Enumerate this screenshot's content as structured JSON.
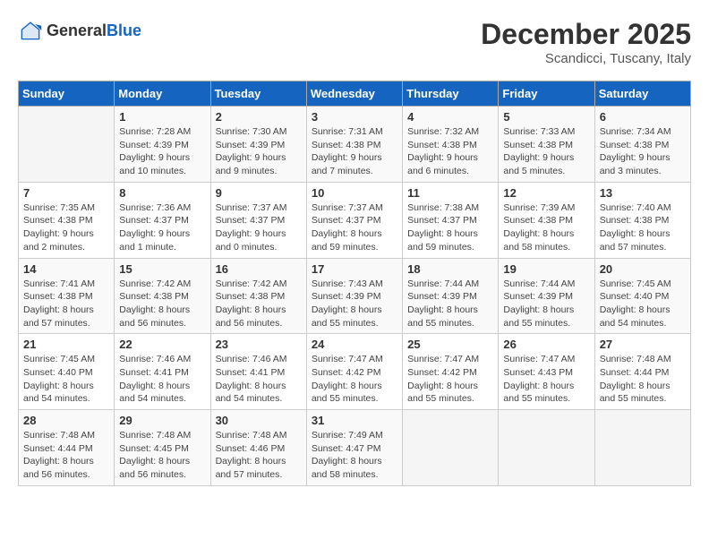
{
  "header": {
    "logo_general": "General",
    "logo_blue": "Blue",
    "month_year": "December 2025",
    "location": "Scandicci, Tuscany, Italy"
  },
  "days_of_week": [
    "Sunday",
    "Monday",
    "Tuesday",
    "Wednesday",
    "Thursday",
    "Friday",
    "Saturday"
  ],
  "weeks": [
    [
      {
        "day": "",
        "info": ""
      },
      {
        "day": "1",
        "info": "Sunrise: 7:28 AM\nSunset: 4:39 PM\nDaylight: 9 hours\nand 10 minutes."
      },
      {
        "day": "2",
        "info": "Sunrise: 7:30 AM\nSunset: 4:39 PM\nDaylight: 9 hours\nand 9 minutes."
      },
      {
        "day": "3",
        "info": "Sunrise: 7:31 AM\nSunset: 4:38 PM\nDaylight: 9 hours\nand 7 minutes."
      },
      {
        "day": "4",
        "info": "Sunrise: 7:32 AM\nSunset: 4:38 PM\nDaylight: 9 hours\nand 6 minutes."
      },
      {
        "day": "5",
        "info": "Sunrise: 7:33 AM\nSunset: 4:38 PM\nDaylight: 9 hours\nand 5 minutes."
      },
      {
        "day": "6",
        "info": "Sunrise: 7:34 AM\nSunset: 4:38 PM\nDaylight: 9 hours\nand 3 minutes."
      }
    ],
    [
      {
        "day": "7",
        "info": "Sunrise: 7:35 AM\nSunset: 4:38 PM\nDaylight: 9 hours\nand 2 minutes."
      },
      {
        "day": "8",
        "info": "Sunrise: 7:36 AM\nSunset: 4:37 PM\nDaylight: 9 hours\nand 1 minute."
      },
      {
        "day": "9",
        "info": "Sunrise: 7:37 AM\nSunset: 4:37 PM\nDaylight: 9 hours\nand 0 minutes."
      },
      {
        "day": "10",
        "info": "Sunrise: 7:37 AM\nSunset: 4:37 PM\nDaylight: 8 hours\nand 59 minutes."
      },
      {
        "day": "11",
        "info": "Sunrise: 7:38 AM\nSunset: 4:37 PM\nDaylight: 8 hours\nand 59 minutes."
      },
      {
        "day": "12",
        "info": "Sunrise: 7:39 AM\nSunset: 4:38 PM\nDaylight: 8 hours\nand 58 minutes."
      },
      {
        "day": "13",
        "info": "Sunrise: 7:40 AM\nSunset: 4:38 PM\nDaylight: 8 hours\nand 57 minutes."
      }
    ],
    [
      {
        "day": "14",
        "info": "Sunrise: 7:41 AM\nSunset: 4:38 PM\nDaylight: 8 hours\nand 57 minutes."
      },
      {
        "day": "15",
        "info": "Sunrise: 7:42 AM\nSunset: 4:38 PM\nDaylight: 8 hours\nand 56 minutes."
      },
      {
        "day": "16",
        "info": "Sunrise: 7:42 AM\nSunset: 4:38 PM\nDaylight: 8 hours\nand 56 minutes."
      },
      {
        "day": "17",
        "info": "Sunrise: 7:43 AM\nSunset: 4:39 PM\nDaylight: 8 hours\nand 55 minutes."
      },
      {
        "day": "18",
        "info": "Sunrise: 7:44 AM\nSunset: 4:39 PM\nDaylight: 8 hours\nand 55 minutes."
      },
      {
        "day": "19",
        "info": "Sunrise: 7:44 AM\nSunset: 4:39 PM\nDaylight: 8 hours\nand 55 minutes."
      },
      {
        "day": "20",
        "info": "Sunrise: 7:45 AM\nSunset: 4:40 PM\nDaylight: 8 hours\nand 54 minutes."
      }
    ],
    [
      {
        "day": "21",
        "info": "Sunrise: 7:45 AM\nSunset: 4:40 PM\nDaylight: 8 hours\nand 54 minutes."
      },
      {
        "day": "22",
        "info": "Sunrise: 7:46 AM\nSunset: 4:41 PM\nDaylight: 8 hours\nand 54 minutes."
      },
      {
        "day": "23",
        "info": "Sunrise: 7:46 AM\nSunset: 4:41 PM\nDaylight: 8 hours\nand 54 minutes."
      },
      {
        "day": "24",
        "info": "Sunrise: 7:47 AM\nSunset: 4:42 PM\nDaylight: 8 hours\nand 55 minutes."
      },
      {
        "day": "25",
        "info": "Sunrise: 7:47 AM\nSunset: 4:42 PM\nDaylight: 8 hours\nand 55 minutes."
      },
      {
        "day": "26",
        "info": "Sunrise: 7:47 AM\nSunset: 4:43 PM\nDaylight: 8 hours\nand 55 minutes."
      },
      {
        "day": "27",
        "info": "Sunrise: 7:48 AM\nSunset: 4:44 PM\nDaylight: 8 hours\nand 55 minutes."
      }
    ],
    [
      {
        "day": "28",
        "info": "Sunrise: 7:48 AM\nSunset: 4:44 PM\nDaylight: 8 hours\nand 56 minutes."
      },
      {
        "day": "29",
        "info": "Sunrise: 7:48 AM\nSunset: 4:45 PM\nDaylight: 8 hours\nand 56 minutes."
      },
      {
        "day": "30",
        "info": "Sunrise: 7:48 AM\nSunset: 4:46 PM\nDaylight: 8 hours\nand 57 minutes."
      },
      {
        "day": "31",
        "info": "Sunrise: 7:49 AM\nSunset: 4:47 PM\nDaylight: 8 hours\nand 58 minutes."
      },
      {
        "day": "",
        "info": ""
      },
      {
        "day": "",
        "info": ""
      },
      {
        "day": "",
        "info": ""
      }
    ]
  ]
}
